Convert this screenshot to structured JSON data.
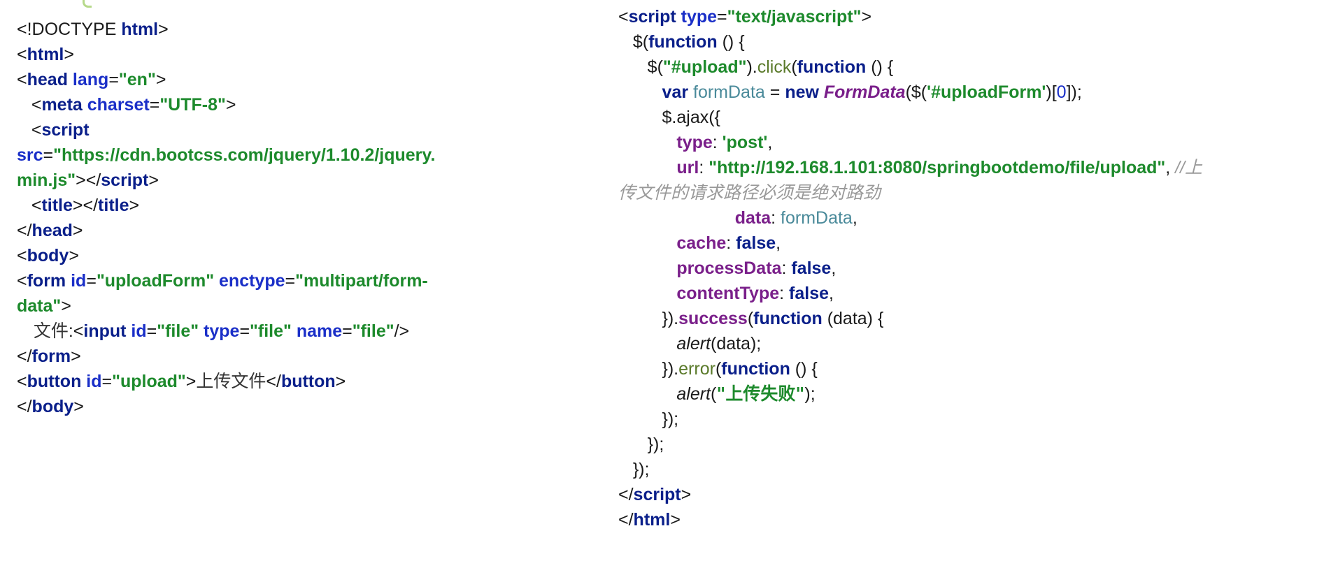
{
  "left_code": [
    [
      [
        "txt",
        "<!DOCTYPE "
      ],
      [
        "tag",
        "html"
      ],
      [
        "txt",
        ">"
      ]
    ],
    [
      [
        "txt",
        "<"
      ],
      [
        "tag",
        "html"
      ],
      [
        "txt",
        ">"
      ]
    ],
    [
      [
        "txt",
        "<"
      ],
      [
        "tag",
        "head "
      ],
      [
        "attr",
        "lang"
      ],
      [
        "txt",
        "="
      ],
      [
        "str",
        "\"en\""
      ],
      [
        "txt",
        ">"
      ]
    ],
    [
      [
        "txt",
        "   <"
      ],
      [
        "tag",
        "meta "
      ],
      [
        "attr",
        "charset"
      ],
      [
        "txt",
        "="
      ],
      [
        "str",
        "\"UTF-8\""
      ],
      [
        "txt",
        ">"
      ]
    ],
    [
      [
        "txt",
        "   <"
      ],
      [
        "tag",
        "script"
      ]
    ],
    [
      [
        "attr",
        "src"
      ],
      [
        "txt",
        "="
      ],
      [
        "str",
        "\"https://cdn.bootcss.com/jquery/1.10.2/jquery."
      ]
    ],
    [
      [
        "str",
        "min.js\""
      ],
      [
        "txt",
        ">"
      ],
      [
        "txt",
        "</"
      ],
      [
        "tag",
        "script"
      ],
      [
        "txt",
        ">"
      ]
    ],
    [
      [
        "txt",
        "   <"
      ],
      [
        "tag",
        "title"
      ],
      [
        "txt",
        "></"
      ],
      [
        "tag",
        "title"
      ],
      [
        "txt",
        ">"
      ]
    ],
    [
      [
        "txt",
        "</"
      ],
      [
        "tag",
        "head"
      ],
      [
        "txt",
        ">"
      ]
    ],
    [
      [
        "txt",
        "<"
      ],
      [
        "tag",
        "body"
      ],
      [
        "txt",
        ">"
      ]
    ],
    [
      [
        "txt",
        "<"
      ],
      [
        "tag",
        "form "
      ],
      [
        "attr",
        "id"
      ],
      [
        "txt",
        "="
      ],
      [
        "str",
        "\"uploadForm\" "
      ],
      [
        "attr",
        "enctype"
      ],
      [
        "txt",
        "="
      ],
      [
        "str",
        "\"multipart/form-"
      ]
    ],
    [
      [
        "str",
        "data\""
      ],
      [
        "txt",
        ">"
      ]
    ],
    [
      [
        "cjk",
        "   文件"
      ],
      [
        "txt",
        ":<"
      ],
      [
        "tag",
        "input "
      ],
      [
        "attr",
        "id"
      ],
      [
        "txt",
        "="
      ],
      [
        "str",
        "\"file\" "
      ],
      [
        "attr",
        "type"
      ],
      [
        "txt",
        "="
      ],
      [
        "str",
        "\"file\" "
      ],
      [
        "attr",
        "name"
      ],
      [
        "txt",
        "="
      ],
      [
        "str",
        "\"file\""
      ],
      [
        "txt",
        "/>"
      ]
    ],
    [
      [
        "txt",
        "</"
      ],
      [
        "tag",
        "form"
      ],
      [
        "txt",
        ">"
      ]
    ],
    [
      [
        "txt",
        "<"
      ],
      [
        "tag",
        "button "
      ],
      [
        "attr",
        "id"
      ],
      [
        "txt",
        "="
      ],
      [
        "str",
        "\"upload\""
      ],
      [
        "txt",
        ">"
      ],
      [
        "cjk",
        "上传文件"
      ],
      [
        "txt",
        "</"
      ],
      [
        "tag",
        "button"
      ],
      [
        "txt",
        ">"
      ]
    ],
    [
      [
        "txt",
        "</"
      ],
      [
        "tag",
        "body"
      ],
      [
        "txt",
        ">"
      ]
    ]
  ],
  "right_code": [
    [
      [
        "txt",
        "<"
      ],
      [
        "tag",
        "script "
      ],
      [
        "attr",
        "type"
      ],
      [
        "txt",
        "="
      ],
      [
        "str",
        "\"text/javascript\""
      ],
      [
        "txt",
        ">"
      ]
    ],
    [
      [
        "txt",
        "   $("
      ],
      [
        "kw",
        "function "
      ],
      [
        "txt",
        "() {"
      ]
    ],
    [
      [
        "txt",
        "      $("
      ],
      [
        "str",
        "\"#upload\""
      ],
      [
        "txt",
        ")."
      ],
      [
        "fn",
        "click"
      ],
      [
        "txt",
        "("
      ],
      [
        "kw",
        "function "
      ],
      [
        "txt",
        "() {"
      ]
    ],
    [
      [
        "txt",
        "         "
      ],
      [
        "kw",
        "var "
      ],
      [
        "var",
        "formData"
      ],
      [
        "txt",
        " = "
      ],
      [
        "kw",
        "new "
      ],
      [
        "cls",
        "FormData"
      ],
      [
        "txt",
        "($("
      ],
      [
        "str",
        "'#uploadForm'"
      ],
      [
        "txt",
        ")["
      ],
      [
        "num",
        "0"
      ],
      [
        "txt",
        "]);"
      ]
    ],
    [
      [
        "txt",
        "         $.ajax({"
      ]
    ],
    [
      [
        "txt",
        "            "
      ],
      [
        "prop",
        "type"
      ],
      [
        "txt",
        ": "
      ],
      [
        "str",
        "'post'"
      ],
      [
        "txt",
        ","
      ]
    ],
    [
      [
        "txt",
        "            "
      ],
      [
        "prop",
        "url"
      ],
      [
        "txt",
        ": "
      ],
      [
        "str",
        "\"http://192.168.1.101:8080/springbootdemo/file/upload\""
      ],
      [
        "txt",
        ", "
      ],
      [
        "cmt",
        "//上"
      ]
    ],
    [
      [
        "cmt",
        "传文件的请求路径必须是绝对路劲"
      ]
    ],
    [
      [
        "txt",
        "                        "
      ],
      [
        "prop",
        "data"
      ],
      [
        "txt",
        ": "
      ],
      [
        "var",
        "formData"
      ],
      [
        "txt",
        ","
      ]
    ],
    [
      [
        "txt",
        "            "
      ],
      [
        "prop",
        "cache"
      ],
      [
        "txt",
        ": "
      ],
      [
        "kw",
        "false"
      ],
      [
        "txt",
        ","
      ]
    ],
    [
      [
        "txt",
        "            "
      ],
      [
        "prop",
        "processData"
      ],
      [
        "txt",
        ": "
      ],
      [
        "kw",
        "false"
      ],
      [
        "txt",
        ","
      ]
    ],
    [
      [
        "txt",
        "            "
      ],
      [
        "prop",
        "contentType"
      ],
      [
        "txt",
        ": "
      ],
      [
        "kw",
        "false"
      ],
      [
        "txt",
        ","
      ]
    ],
    [
      [
        "txt",
        "         })."
      ],
      [
        "prop",
        "success"
      ],
      [
        "txt",
        "("
      ],
      [
        "kw",
        "function "
      ],
      [
        "txt",
        "(data) {"
      ]
    ],
    [
      [
        "txt",
        "            "
      ],
      [
        "ital",
        "alert"
      ],
      [
        "txt",
        "(data);"
      ]
    ],
    [
      [
        "txt",
        "         })."
      ],
      [
        "fn",
        "error"
      ],
      [
        "txt",
        "("
      ],
      [
        "kw",
        "function "
      ],
      [
        "txt",
        "() {"
      ]
    ],
    [
      [
        "txt",
        "            "
      ],
      [
        "ital",
        "alert"
      ],
      [
        "txt",
        "("
      ],
      [
        "strcjk",
        "\"上传失败\""
      ],
      [
        "txt",
        ");"
      ]
    ],
    [
      [
        "txt",
        "         });"
      ]
    ],
    [
      [
        "txt",
        "      });"
      ]
    ],
    [
      [
        "txt",
        "   });"
      ]
    ],
    [
      [
        "txt",
        "</"
      ],
      [
        "tag",
        "script"
      ],
      [
        "txt",
        ">"
      ]
    ],
    [
      [
        "txt",
        "</"
      ],
      [
        "tag",
        "html"
      ],
      [
        "txt",
        ">"
      ]
    ]
  ]
}
